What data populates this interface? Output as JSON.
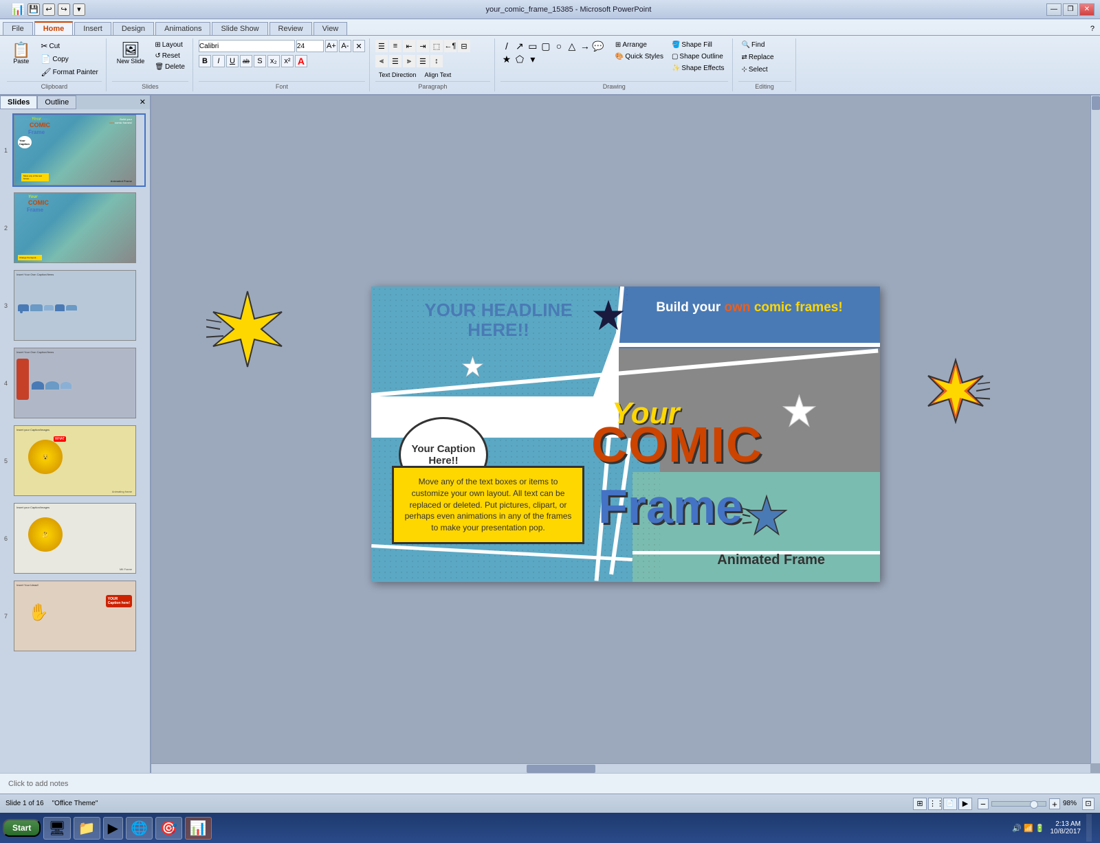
{
  "titleBar": {
    "title": "your_comic_frame_15385 - Microsoft PowerPoint",
    "minBtn": "—",
    "restoreBtn": "❐",
    "closeBtn": "✕"
  },
  "quickAccess": {
    "saveIcon": "💾",
    "undoIcon": "↩",
    "redoIcon": "↪",
    "dropIcon": "▾"
  },
  "ribbon": {
    "tabs": [
      "File",
      "Home",
      "Insert",
      "Design",
      "Animations",
      "Slide Show",
      "Review",
      "View"
    ],
    "activeTab": "Home",
    "groups": {
      "clipboard": {
        "label": "Clipboard",
        "paste": "Paste",
        "cut": "Cut",
        "copy": "Copy",
        "formatPainter": "Format Painter"
      },
      "slides": {
        "label": "Slides",
        "newSlide": "New Slide",
        "layout": "Layout",
        "reset": "Reset",
        "delete": "Delete"
      },
      "font": {
        "label": "Font",
        "fontName": "Calibri",
        "fontSize": "24",
        "bold": "B",
        "italic": "I",
        "underline": "U",
        "strikethrough": "ab",
        "shadow": "S",
        "subscript": "x₂",
        "superscript": "x²",
        "fontColor": "A",
        "clearFormatting": "✕"
      },
      "paragraph": {
        "label": "Paragraph",
        "bulletList": "≡",
        "numberedList": "1≡",
        "alignLeft": "⫷",
        "alignCenter": "≡",
        "alignRight": "⫸",
        "justify": "⫸⫷",
        "lineSpacing": "↕",
        "columns": "⊟",
        "textDirection": "Text Direction",
        "alignText": "Align Text",
        "convertSmartArt": "Convert to SmartArt"
      },
      "drawing": {
        "label": "Drawing",
        "shapeFill": "Shape Fill",
        "shapeOutline": "Shape Outline",
        "shapeEffects": "Shape Effects",
        "arrange": "Arrange",
        "quickStyles": "Quick Styles"
      },
      "editing": {
        "label": "Editing",
        "find": "Find",
        "replace": "Replace",
        "select": "Select"
      }
    }
  },
  "slidesPanel": {
    "tabs": [
      "Slides",
      "Outline"
    ],
    "activeTab": "Slides",
    "slideCount": 16,
    "currentSlide": 1
  },
  "mainSlide": {
    "headline": "YOUR HEADLINE HERE!!",
    "buildText": "Build your own comic frames!",
    "comicTitle1": "Your",
    "comicTitle2": "COMIC",
    "comicTitle3": "Frame",
    "captionBubble": "Your Caption Here!!",
    "descriptionBox": "Move any of the text boxes or items to customize your own layout. All text can be replaced or deleted. Put pictures, clipart, or perhaps even animations in any of the frames to make your presentation pop.",
    "animatedLabel": "Animated Frame"
  },
  "status": {
    "slideInfo": "Slide 1 of 16",
    "theme": "\"Office Theme\"",
    "zoom": "98%",
    "time": "2:13 AM",
    "date": "10/8/2017"
  },
  "notes": {
    "placeholder": "Click to add notes"
  },
  "taskbar": {
    "start": "Start",
    "apps": [
      "🖥",
      "📁",
      "▶",
      "🌐",
      "🎯",
      "📊"
    ]
  },
  "colors": {
    "accent": "#4472c4",
    "teal": "#5ba8c4",
    "yellow": "#ffd700",
    "orange": "#e86020",
    "red": "#cc4400",
    "gray": "#888888",
    "lightTeal": "#7bbcb0",
    "darkGray": "#606060"
  }
}
